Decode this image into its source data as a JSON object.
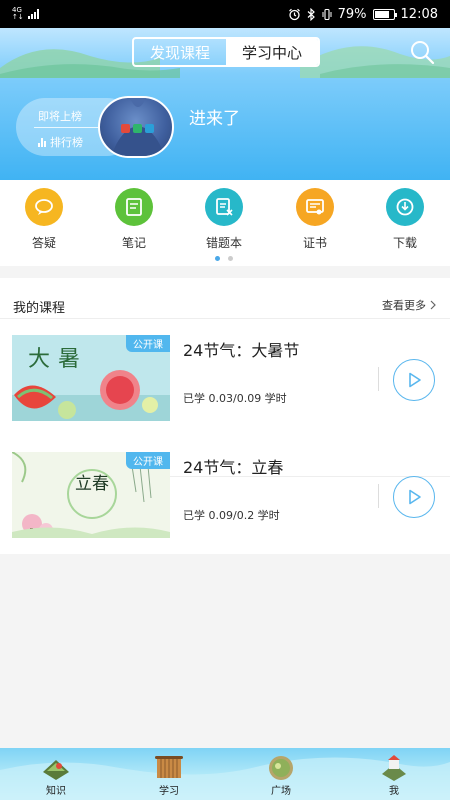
{
  "status_bar": {
    "network_top": "4G",
    "network_bottom": "↑↓",
    "battery_percent": "79%",
    "time": "12:08",
    "battery_level": 0.79
  },
  "header": {
    "tabs": [
      {
        "label": "发现课程",
        "active": false
      },
      {
        "label": "学习中心",
        "active": true
      }
    ],
    "rank_label_top": "即将上榜",
    "rank_label_bottom": "排行榜",
    "greeting": "进来了"
  },
  "tools": [
    {
      "label": "答疑",
      "icon": "chat-bubble-icon",
      "color": "#f6b621"
    },
    {
      "label": "笔记",
      "icon": "notebook-icon",
      "color": "#5dc23a"
    },
    {
      "label": "错题本",
      "icon": "wrong-book-icon",
      "color": "#27b8c9"
    },
    {
      "label": "证书",
      "icon": "certificate-icon",
      "color": "#f6a623"
    },
    {
      "label": "下载",
      "icon": "download-icon",
      "color": "#27b8c9"
    }
  ],
  "carousel_page": 1,
  "courses": {
    "title": "我的课程",
    "more_label": "查看更多",
    "items": [
      {
        "tag": "公开课",
        "name": "24节气：大暑节",
        "progress": "已学 0.03/0.09 学时",
        "thumb_text": "大暑"
      },
      {
        "tag": "公开课",
        "name": "24节气：立春",
        "progress": "已学 0.09/0.2 学时",
        "thumb_text": "立春"
      }
    ]
  },
  "bottom_nav": [
    {
      "label": "知识",
      "icon": "knowledge-icon"
    },
    {
      "label": "学习",
      "icon": "study-icon"
    },
    {
      "label": "广场",
      "icon": "square-icon"
    },
    {
      "label": "我",
      "icon": "profile-icon"
    }
  ]
}
